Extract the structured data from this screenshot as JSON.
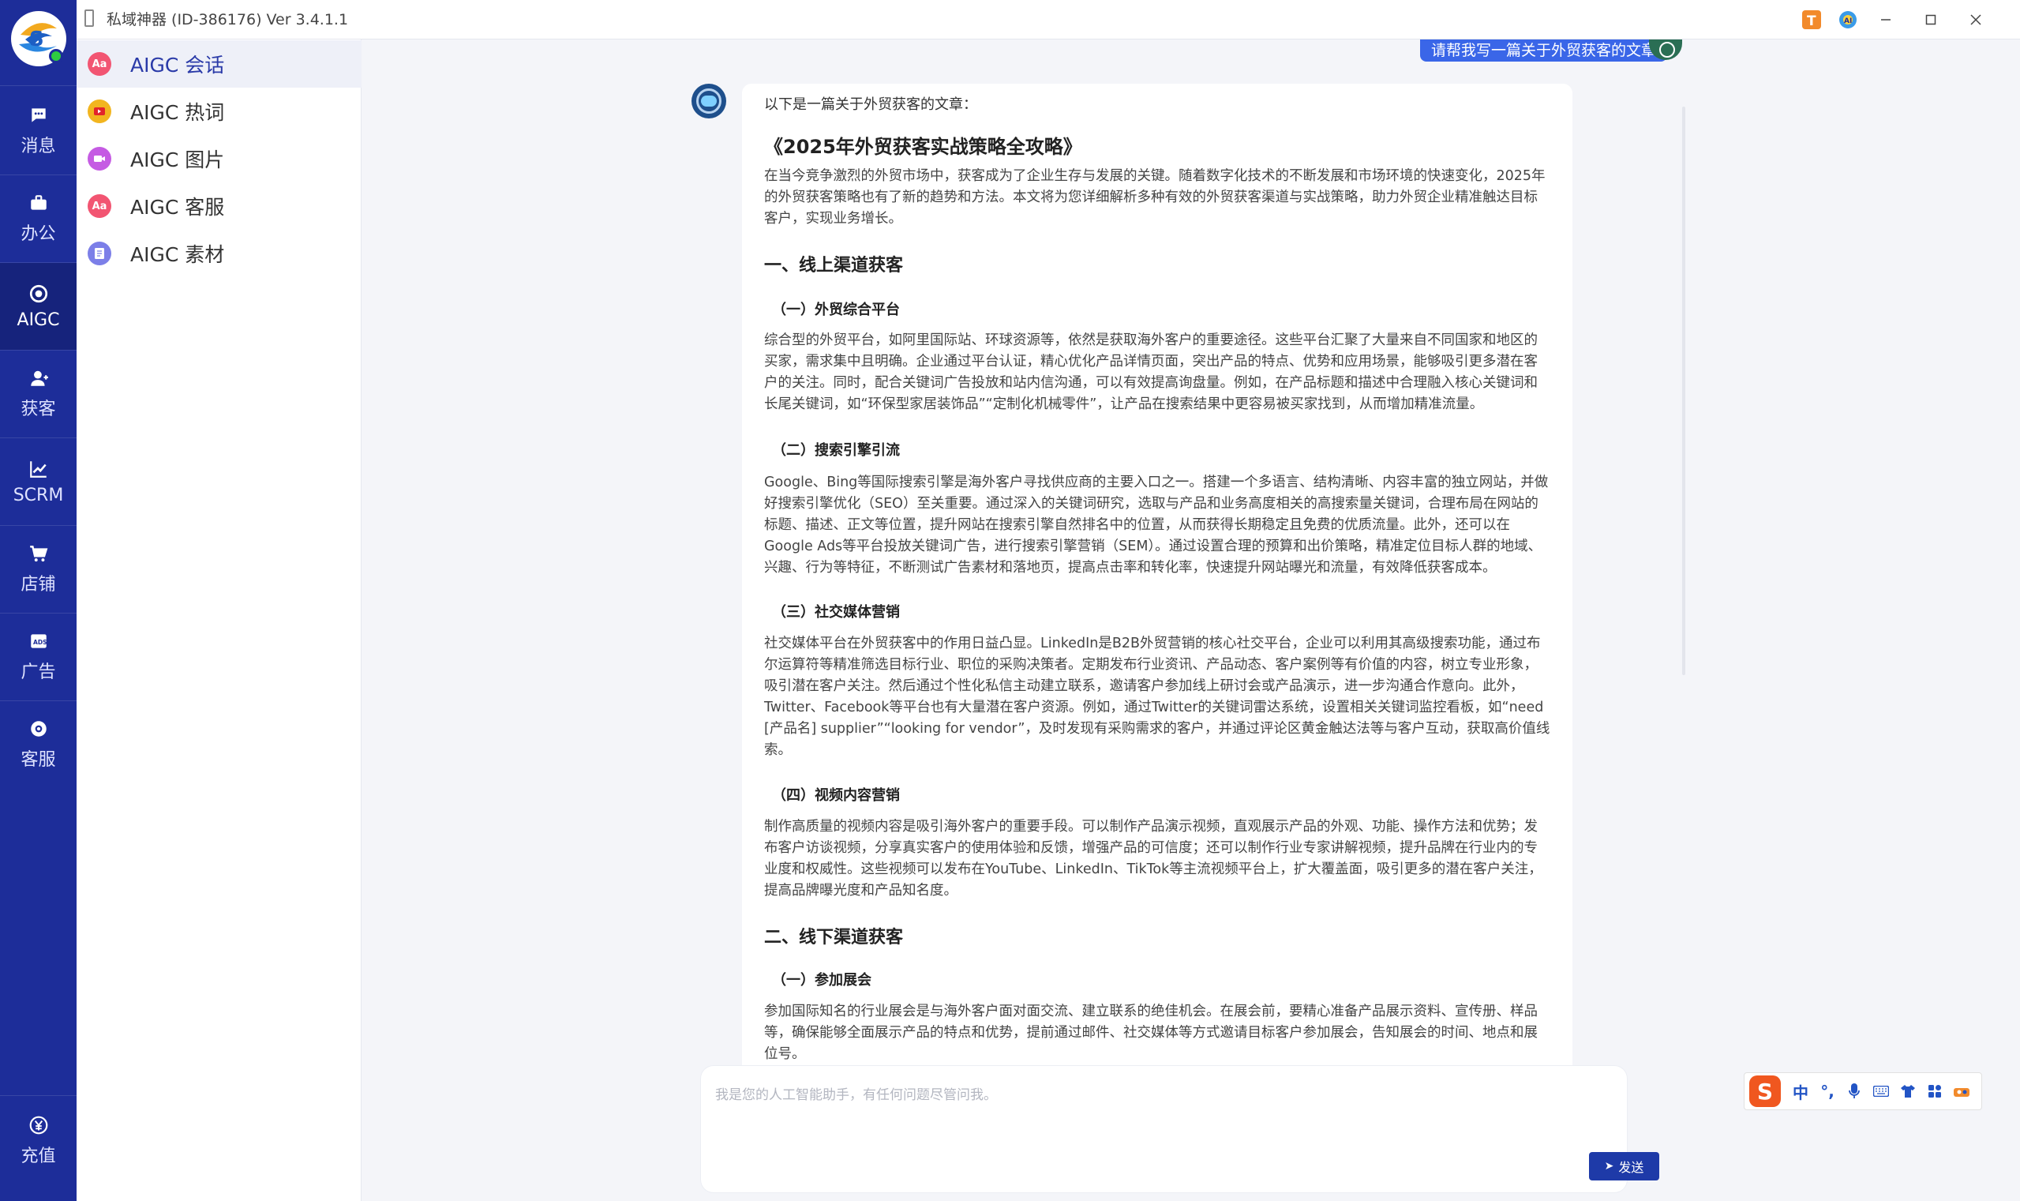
{
  "window": {
    "title": "私域神器 (ID-386176)  Ver 3.4.1.1"
  },
  "nav": {
    "items": [
      {
        "label": "消息",
        "icon": "chat-bubble-icon"
      },
      {
        "label": "办公",
        "icon": "briefcase-icon"
      },
      {
        "label": "AIGC",
        "icon": "aigc-icon"
      },
      {
        "label": "获客",
        "icon": "user-plus-icon"
      },
      {
        "label": "SCRM",
        "icon": "trend-chart-icon"
      },
      {
        "label": "店铺",
        "icon": "shopping-cart-icon"
      },
      {
        "label": "广告",
        "icon": "ads-icon"
      },
      {
        "label": "客服",
        "icon": "headset-icon"
      }
    ],
    "bottom": {
      "label": "充值",
      "icon": "yen-coin-icon"
    }
  },
  "subnav": {
    "items": [
      {
        "label": "AIGC 会话",
        "icon_text": "Aa",
        "color": "#f25572"
      },
      {
        "label": "AIGC 热词",
        "icon_text": "▶",
        "color": "#f2b51f"
      },
      {
        "label": "AIGC 图片",
        "icon_text": "■",
        "color": "#c55be3"
      },
      {
        "label": "AIGC 客服",
        "icon_text": "Aa",
        "color": "#f25572"
      },
      {
        "label": "AIGC 素材",
        "icon_text": "≡",
        "color": "#7c7fe8"
      }
    ]
  },
  "chat": {
    "user_message": "请帮我写一篇关于外贸获客的文章",
    "intro": "以下是一篇关于外贸获客的文章：",
    "article_title": "《2025年外贸获客实战策略全攻略》",
    "p_intro": "在当今竞争激烈的外贸市场中，获客成为了企业生存与发展的关键。随着数字化技术的不断发展和市场环境的快速变化，2025年的外贸获客策略也有了新的趋势和方法。本文将为您详细解析多种有效的外贸获客渠道与实战策略，助力外贸企业精准触达目标客户，实现业务增长。",
    "h_online": "一、线上渠道获客",
    "h_platform": "（一）外贸综合平台",
    "p_platform": "综合型的外贸平台，如阿里国际站、环球资源等，依然是获取海外客户的重要途径。这些平台汇聚了大量来自不同国家和地区的买家，需求集中且明确。企业通过平台认证，精心优化产品详情页面，突出产品的特点、优势和应用场景，能够吸引更多潜在客户的关注。同时，配合关键词广告投放和站内信沟通，可以有效提高询盘量。例如，在产品标题和描述中合理融入核心关键词和长尾关键词，如“环保型家居装饰品”“定制化机械零件”，让产品在搜索结果中更容易被买家找到，从而增加精准流量。",
    "h_search": "（二）搜索引擎引流",
    "p_search": "Google、Bing等国际搜索引擎是海外客户寻找供应商的主要入口之一。搭建一个多语言、结构清晰、内容丰富的独立网站，并做好搜索引擎优化（SEO）至关重要。通过深入的关键词研究，选取与产品和业务高度相关的高搜索量关键词，合理布局在网站的标题、描述、正文等位置，提升网站在搜索引擎自然排名中的位置，从而获得长期稳定且免费的优质流量。此外，还可以在Google Ads等平台投放关键词广告，进行搜索引擎营销（SEM）。通过设置合理的预算和出价策略，精准定位目标人群的地域、兴趣、行为等特征，不断测试广告素材和落地页，提高点击率和转化率，快速提升网站曝光和流量，有效降低获客成本。",
    "h_social": "（三）社交媒体营销",
    "p_social": "社交媒体平台在外贸获客中的作用日益凸显。LinkedIn是B2B外贸营销的核心社交平台，企业可以利用其高级搜索功能，通过布尔运算符等精准筛选目标行业、职位的采购决策者。定期发布行业资讯、产品动态、客户案例等有价值的内容，树立专业形象，吸引潜在客户关注。然后通过个性化私信主动建立联系，邀请客户参加线上研讨会或产品演示，进一步沟通合作意向。此外，Twitter、Facebook等平台也有大量潜在客户资源。例如，通过Twitter的关键词雷达系统，设置相关关键词监控看板，如“need [产品名] supplier”“looking for vendor”，及时发现有采购需求的客户，并通过评论区黄金触达法等与客户互动，获取高价值线索。",
    "h_video": "（四）视频内容营销",
    "p_video": "制作高质量的视频内容是吸引海外客户的重要手段。可以制作产品演示视频，直观展示产品的外观、功能、操作方法和优势；发布客户访谈视频，分享真实客户的使用体验和反馈，增强产品的可信度；还可以制作行业专家讲解视频，提升品牌在行业内的专业度和权威性。这些视频可以发布在YouTube、LinkedIn、TikTok等主流视频平台上，扩大覆盖面，吸引更多的潜在客户关注，提高品牌曝光度和产品知名度。",
    "h_offline": "二、线下渠道获客",
    "h_exhibition": "（一）参加展会",
    "p_exhibition": "参加国际知名的行业展会是与海外客户面对面交流、建立联系的绝佳机会。在展会前，要精心准备产品展示资料、宣传册、样品等，确保能够全面展示产品的特点和优势，提前通过邮件、社交媒体等方式邀请目标客户参加展会，告知展会的时间、地点和展位号。"
  },
  "input": {
    "placeholder": "我是您的人工智能助手，有任何问题尽管问我。",
    "value": "",
    "send_label": "发送"
  },
  "ime": {
    "logo": "S",
    "items": [
      "中",
      "°,",
      "mic-icon",
      "keyboard-icon",
      "shirt-icon",
      "grid-icon",
      "toolbox-icon"
    ]
  }
}
